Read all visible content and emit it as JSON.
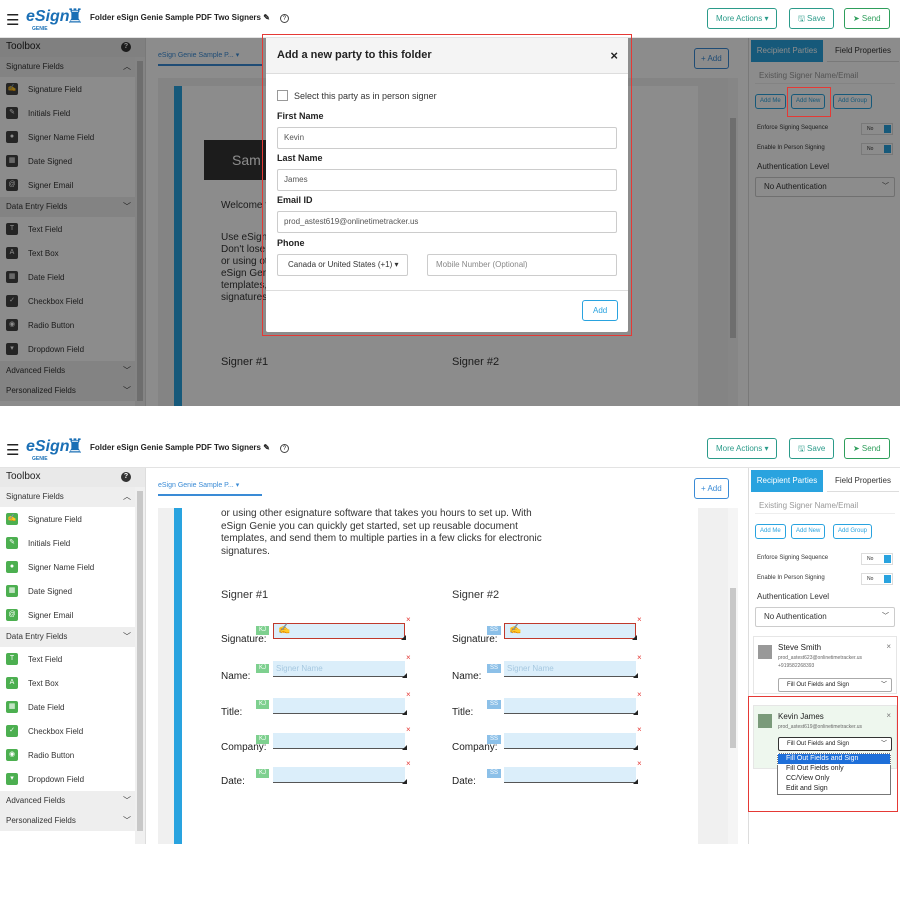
{
  "app": {
    "logo_text": "eSign",
    "logo_sub": "GENIE",
    "doc_title": "Folder eSign Genie Sample PDF Two Signers",
    "help_glyph": "?"
  },
  "header": {
    "more_actions": "More Actions ▾",
    "save": "🖫 Save",
    "send": "➤ Send"
  },
  "toolbox": {
    "title": "Toolbox",
    "signature_fields": "Signature Fields",
    "signature_items": [
      "Signature Field",
      "Initials Field",
      "Signer Name Field",
      "Date Signed",
      "Signer Email"
    ],
    "data_entry_fields": "Data Entry Fields",
    "data_items": [
      "Text Field",
      "Text Box",
      "Date Field",
      "Checkbox Field",
      "Radio Button",
      "Dropdown Field"
    ],
    "advanced_fields": "Advanced Fields",
    "personalized_fields": "Personalized Fields"
  },
  "main": {
    "tab_label": "eSign Genie Sample P...",
    "add_button": "+ Add"
  },
  "right_panel": {
    "tab_recipients": "Recipient Parties",
    "tab_field_props": "Field Properties",
    "existing_signer_placeholder": "Existing Signer Name/Email",
    "add_me": "Add Me",
    "add_new": "Add New",
    "add_group": "Add Group",
    "enforce_sequence": "Enforce Signing Sequence",
    "in_person": "Enable In Person Signing",
    "toggle_no": "No",
    "auth_level_label": "Authentication Level",
    "auth_level_value": "No Authentication"
  },
  "modal": {
    "title": "Add a new party to this folder",
    "close": "×",
    "in_person_checkbox": "Select this party as in person signer",
    "first_name_label": "First Name",
    "first_name_value": "Kevin",
    "last_name_label": "Last Name",
    "last_name_value": "James",
    "email_label": "Email ID",
    "email_value": "prod_astest619@onlinetimetracker.us",
    "phone_label": "Phone",
    "country_code": "Canada or United States (+1) ▾",
    "mobile_placeholder": "Mobile Number (Optional)",
    "add_button": "Add"
  },
  "doc_top": {
    "sample_banner": "Sam",
    "welcome": "Welcome t",
    "lines": [
      "Use eSign",
      "Don't lose",
      "or using ot",
      "eSign Geni",
      "templates,",
      "signatures"
    ],
    "signer1": "Signer #1",
    "signer2": "Signer #2"
  },
  "doc_bottom": {
    "lines": [
      "or using other esignature software that takes you hours to set up. With",
      "eSign Genie you can quickly get started, set up reusable document",
      "templates, and send them to multiple parties in a few clicks for electronic",
      "signatures."
    ],
    "signer1": "Signer #1",
    "signer2": "Signer #2",
    "field_labels": [
      "Signature:",
      "Name:",
      "Title:",
      "Company:",
      "Date:"
    ],
    "tag_signer1": "KJ",
    "tag_signer2": "SS",
    "name_placeholder": "Signer Name",
    "remove_glyph": "×"
  },
  "parties": [
    {
      "name": "Steve Smith",
      "email": "prod_astest623@onlinetimetracker.us",
      "phone": "+919582268393",
      "role": "Fill Out Fields and Sign"
    },
    {
      "name": "Kevin James",
      "email": "prod_astest619@onlinetimetracker.us",
      "phone": "",
      "role": "Fill Out Fields and Sign"
    }
  ],
  "role_options": [
    "Fill Out Fields and Sign",
    "Fill Out Fields only",
    "CC/View Only",
    "Edit and Sign"
  ],
  "colors": {
    "accent": "#29a3df",
    "highlight": "#e53935",
    "send_green": "#2e9e5b"
  }
}
